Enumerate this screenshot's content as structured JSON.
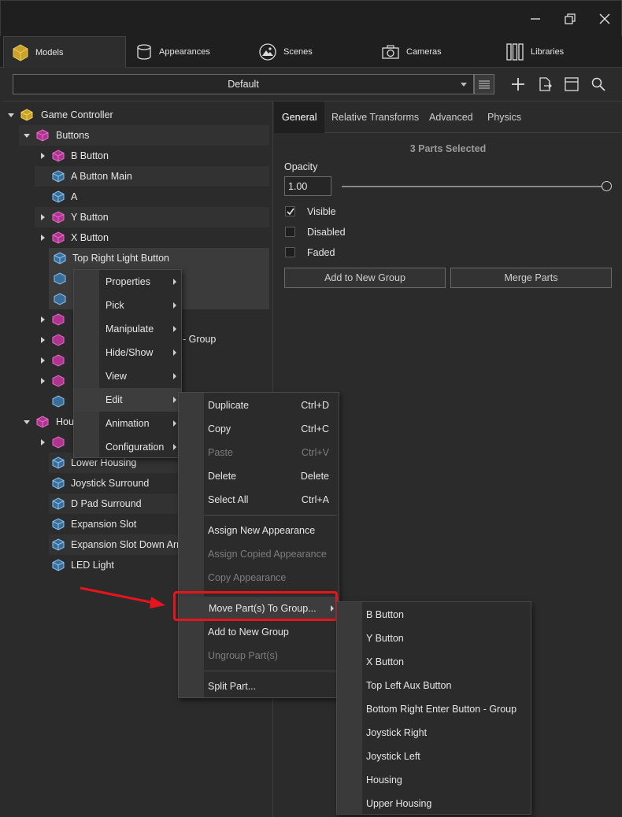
{
  "window": {
    "minimize": "minimize",
    "restore": "restore",
    "close": "close"
  },
  "top_tabs": [
    {
      "label": "Models",
      "icon": "cube-icon"
    },
    {
      "label": "Appearances",
      "icon": "cylinder-icon"
    },
    {
      "label": "Scenes",
      "icon": "image-icon"
    },
    {
      "label": "Cameras",
      "icon": "camera-icon"
    },
    {
      "label": "Libraries",
      "icon": "library-icon"
    }
  ],
  "toolbar": {
    "dropdown_value": "Default"
  },
  "tree": {
    "root": "Game Controller",
    "buttons_group": "Buttons",
    "items": [
      "B Button",
      "A Button Main",
      "A",
      "Y Button",
      "X Button",
      "Top Right Light Button"
    ],
    "partial_row": "- Group",
    "housing_group_partial": "Hou",
    "housing_items": [
      "Lower Housing",
      "Joystick Surround",
      "D Pad Surround",
      "Expansion Slot",
      "Expansion Slot  Down Arr",
      "LED Light"
    ]
  },
  "props": {
    "tabs": [
      "General",
      "Relative Transforms",
      "Advanced",
      "Physics"
    ],
    "selection_status": "3 Parts Selected",
    "opacity_label": "Opacity",
    "opacity_value": "1.00",
    "opacity_level": 1.0,
    "visible_label": "Visible",
    "disabled_label": "Disabled",
    "faded_label": "Faded",
    "visible_checked": true,
    "add_group_button": "Add to New Group",
    "merge_button": "Merge Parts"
  },
  "menu1": {
    "items": [
      "Properties",
      "Pick",
      "Manipulate",
      "Hide/Show",
      "View",
      "Edit",
      "Animation",
      "Configuration"
    ]
  },
  "menu2": {
    "duplicate": "Duplicate",
    "duplicate_sc": "Ctrl+D",
    "copy": "Copy",
    "copy_sc": "Ctrl+C",
    "paste": "Paste",
    "paste_sc": "Ctrl+V",
    "delete": "Delete",
    "delete_sc": "Delete",
    "select_all": "Select All",
    "select_all_sc": "Ctrl+A",
    "assign_new": "Assign New Appearance",
    "assign_copied": "Assign Copied Appearance",
    "copy_appearance": "Copy Appearance",
    "move_parts": "Move Part(s) To Group...",
    "add_new_group": "Add to New Group",
    "ungroup": "Ungroup Part(s)",
    "split": "Split Part..."
  },
  "menu3": {
    "items": [
      "B Button",
      "Y Button",
      "X Button",
      "Top Left Aux Button",
      "Bottom Right Enter Button - Group",
      "Joystick Right",
      "Joystick Left",
      "Housing",
      "Upper Housing"
    ]
  },
  "colors": {
    "highlight_box": "#e8141b",
    "arrow": "#e8141b",
    "part_icon_blue": "#5aa0d8",
    "group_icon_magenta": "#c03a9e",
    "root_icon_yellow": "#d8b232"
  }
}
